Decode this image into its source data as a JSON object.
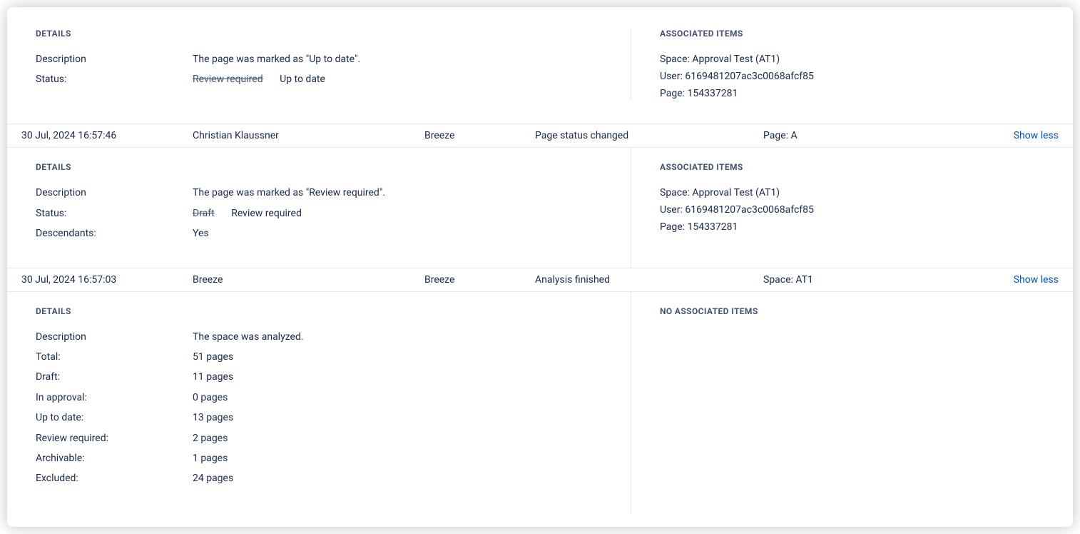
{
  "labels": {
    "details": "DETAILS",
    "associated_items": "ASSOCIATED ITEMS",
    "no_associated_items": "NO ASSOCIATED ITEMS",
    "show_less": "Show less",
    "description": "Description",
    "status": "Status:",
    "descendants": "Descendants:",
    "total": "Total:",
    "draft": "Draft:",
    "in_approval": "In approval:",
    "up_to_date": "Up to date:",
    "review_required": "Review required:",
    "archivable": "Archivable:",
    "excluded": "Excluded:"
  },
  "panel0": {
    "description": "The page was marked as \"Up to date\".",
    "status_old": "Review required",
    "status_new": "Up to date",
    "assoc": {
      "space": "Space: Approval Test (AT1)",
      "user": "User: 6169481207ac3c0068afcf85",
      "page": "Page: 154337281"
    }
  },
  "row1": {
    "date": "30 Jul, 2024 16:57:46",
    "user": "Christian Klaussner",
    "app": "Breeze",
    "action": "Page status changed",
    "ref": "Page: A"
  },
  "panel1": {
    "description": "The page was marked as \"Review required\".",
    "status_old": "Draft",
    "status_new": "Review required",
    "descendants": "Yes",
    "assoc": {
      "space": "Space: Approval Test (AT1)",
      "user": "User: 6169481207ac3c0068afcf85",
      "page": "Page: 154337281"
    }
  },
  "row2": {
    "date": "30 Jul, 2024 16:57:03",
    "user": "Breeze",
    "app": "Breeze",
    "action": "Analysis finished",
    "ref": "Space: AT1"
  },
  "panel2": {
    "description": "The space was analyzed.",
    "total": "51 pages",
    "draft": "11 pages",
    "in_approval": "0 pages",
    "up_to_date": "13 pages",
    "review_required": "2 pages",
    "archivable": "1 pages",
    "excluded": "24 pages"
  }
}
